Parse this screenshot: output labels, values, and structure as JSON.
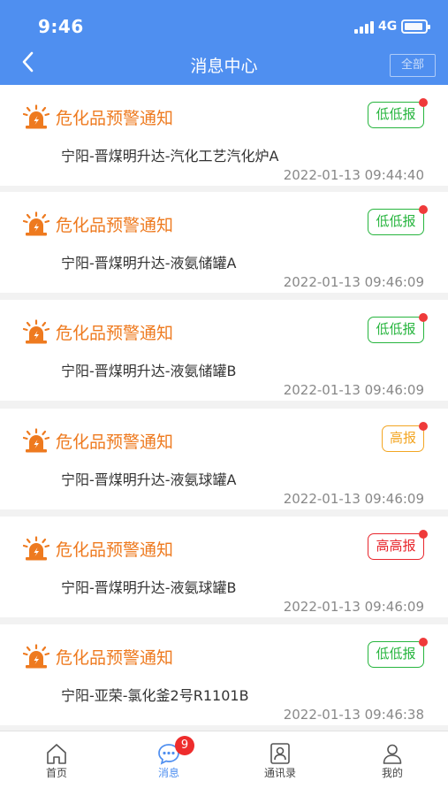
{
  "status_bar": {
    "time": "9:46",
    "network": "4G"
  },
  "nav": {
    "title": "消息中心",
    "all_button": "全部"
  },
  "messages": [
    {
      "title": "危化品预警通知",
      "desc": "宁阳-晋煤明升达-汽化工艺汽化炉A",
      "time": "2022-01-13 09:44:40",
      "level": "低低报",
      "level_type": "low"
    },
    {
      "title": "危化品预警通知",
      "desc": "宁阳-晋煤明升达-液氨储罐A",
      "time": "2022-01-13 09:46:09",
      "level": "低低报",
      "level_type": "low"
    },
    {
      "title": "危化品预警通知",
      "desc": "宁阳-晋煤明升达-液氨储罐B",
      "time": "2022-01-13 09:46:09",
      "level": "低低报",
      "level_type": "low"
    },
    {
      "title": "危化品预警通知",
      "desc": "宁阳-晋煤明升达-液氨球罐A",
      "time": "2022-01-13 09:46:09",
      "level": "高报",
      "level_type": "high"
    },
    {
      "title": "危化品预警通知",
      "desc": "宁阳-晋煤明升达-液氨球罐B",
      "time": "2022-01-13 09:46:09",
      "level": "高高报",
      "level_type": "highhigh"
    },
    {
      "title": "危化品预警通知",
      "desc": "宁阳-亚荣-氯化釜2号R1101B",
      "time": "2022-01-13 09:46:38",
      "level": "低低报",
      "level_type": "low"
    }
  ],
  "level_colors": {
    "low": "#27b53e",
    "high": "#f3a623",
    "highhigh": "#e8262d"
  },
  "alarm_icon_color": "#ee7a1f",
  "tabs": [
    {
      "label": "首页",
      "icon": "home-icon"
    },
    {
      "label": "消息",
      "icon": "message-icon",
      "badge": "9"
    },
    {
      "label": "通讯录",
      "icon": "contacts-icon"
    },
    {
      "label": "我的",
      "icon": "profile-icon"
    }
  ]
}
